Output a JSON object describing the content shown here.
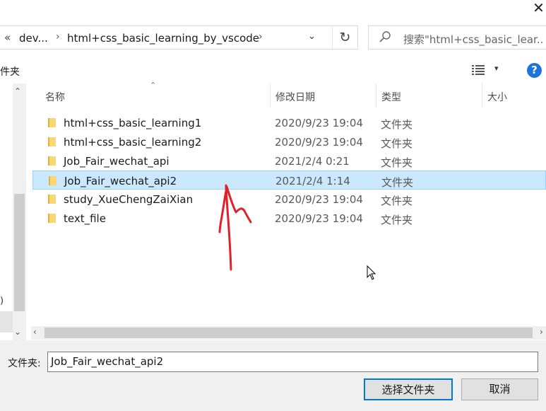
{
  "window": {
    "close_glyph": "✕"
  },
  "address_bar": {
    "prev_glyph": "«",
    "segments": [
      "dev...",
      "html+css_basic_learning_by_vscode"
    ],
    "separator_glyph": "›",
    "dropdown_glyph": "⌄",
    "refresh_glyph": "↻"
  },
  "search": {
    "placeholder": "搜索\"html+css_basic_lear..."
  },
  "toolbar": {
    "left_fragment": "件夹",
    "view_icon": "details-view-icon",
    "view_dropdown_glyph": "▾",
    "help_glyph": "?"
  },
  "nav_pane": {
    "fragment": ")"
  },
  "columns": {
    "name": "名称",
    "date": "修改日期",
    "type": "类型",
    "size": "大小",
    "sort_glyph": "⌃"
  },
  "files": [
    {
      "name": "html+css_basic_learning1",
      "date": "2020/9/23 19:04",
      "type": "文件夹",
      "selected": false
    },
    {
      "name": "html+css_basic_learning2",
      "date": "2020/9/23 19:04",
      "type": "文件夹",
      "selected": false
    },
    {
      "name": "Job_Fair_wechat_api",
      "date": "2021/2/4 0:21",
      "type": "文件夹",
      "selected": false
    },
    {
      "name": "Job_Fair_wechat_api2",
      "date": "2021/2/4 1:14",
      "type": "文件夹",
      "selected": true
    },
    {
      "name": "study_XueChengZaiXian",
      "date": "2020/9/23 19:04",
      "type": "文件夹",
      "selected": false
    },
    {
      "name": "text_file",
      "date": "2020/9/23 19:04",
      "type": "文件夹",
      "selected": false
    }
  ],
  "scrollbars": {
    "up": "⌃",
    "down": "⌄",
    "left": "‹",
    "right": "›"
  },
  "footer": {
    "folder_label": "文件夹:",
    "folder_value": "Job_Fair_wechat_api2",
    "select_button": "选择文件夹",
    "cancel_button": "取消"
  },
  "colors": {
    "selection_bg": "#cce8ff",
    "selection_border": "#99d1ff",
    "folder_yellow": "#f8d775",
    "accent": "#0078d7",
    "annotation_red": "#e0202a"
  }
}
